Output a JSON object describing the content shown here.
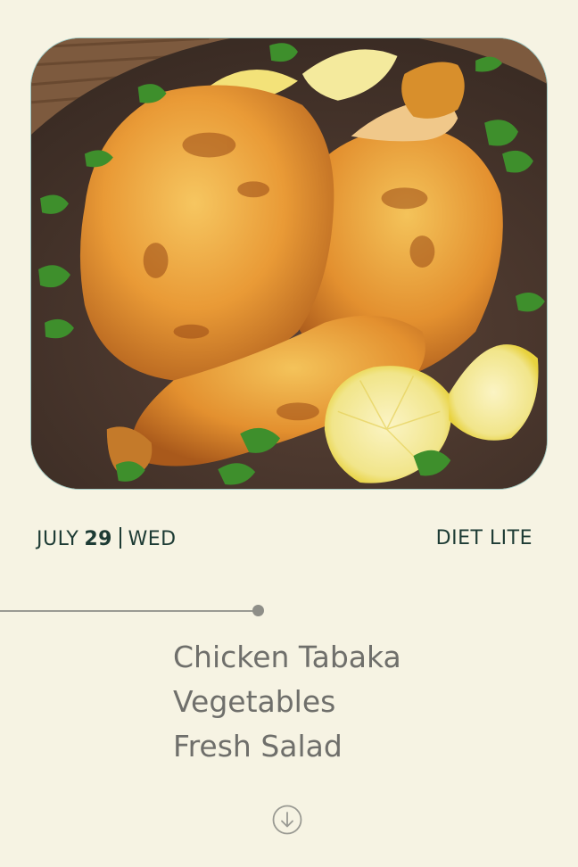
{
  "photo": {
    "alt": ""
  },
  "date": {
    "month": "JULY",
    "day": "29",
    "weekday": "WED"
  },
  "diet": {
    "label": "DIET LITE"
  },
  "menu": {
    "items": [
      "Chicken Tabaka",
      "Vegetables",
      "Fresh Salad"
    ]
  },
  "icons": {
    "scroll": "arrow-down-circle-icon"
  },
  "colors": {
    "background": "#f6f3e3",
    "heading_text": "#1d3b34",
    "menu_text": "#6f6f6b",
    "frame_border": "#9fc6c0"
  }
}
